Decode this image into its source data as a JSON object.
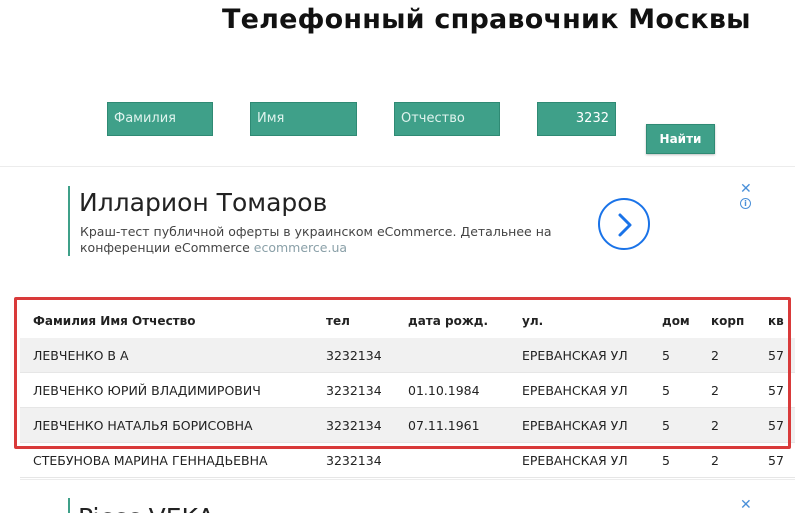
{
  "page": {
    "title": "Телефонный справочник Москвы"
  },
  "search": {
    "surname_placeholder": "Фамилия",
    "name_placeholder": "Имя",
    "patronymic_placeholder": "Отчество",
    "phone_value": "3232",
    "submit_label": "Найти"
  },
  "ad": {
    "title": "Илларион Томаров",
    "description": "Краш-тест публичной оферты в украинском eCommerce. Детальнее на конференции eCommerce",
    "domain": "ecommerce.ua",
    "close_glyph": "✕",
    "info_glyph": "i"
  },
  "ad2": {
    "title_partial": "Piccc VEKA",
    "close_glyph": "✕"
  },
  "table": {
    "headers": {
      "name": "Фамилия Имя Отчество",
      "tel": "тел",
      "dob": "дата рожд.",
      "street": "ул.",
      "house": "дом",
      "korp": "корп",
      "kv": "кв"
    },
    "rows": [
      {
        "name": "ЛЕВЧЕНКО В А",
        "tel": "3232134",
        "dob": "",
        "street": "ЕРЕВАНСКАЯ УЛ",
        "house": "5",
        "korp": "2",
        "kv": "57"
      },
      {
        "name": "ЛЕВЧЕНКО ЮРИЙ ВЛАДИМИРОВИЧ",
        "tel": "3232134",
        "dob": "01.10.1984",
        "street": "ЕРЕВАНСКАЯ УЛ",
        "house": "5",
        "korp": "2",
        "kv": "57"
      },
      {
        "name": "ЛЕВЧЕНКО НАТАЛЬЯ БОРИСОВНА",
        "tel": "3232134",
        "dob": "07.11.1961",
        "street": "ЕРЕВАНСКАЯ УЛ",
        "house": "5",
        "korp": "2",
        "kv": "57"
      },
      {
        "name": "СТЕБУНОВА МАРИНА ГЕННАДЬЕВНА",
        "tel": "3232134",
        "dob": "",
        "street": "ЕРЕВАНСКАЯ УЛ",
        "house": "5",
        "korp": "2",
        "kv": "57"
      }
    ]
  },
  "colors": {
    "accent": "#3fa089",
    "highlight": "#d93a3a",
    "ad_link": "#1a73e8"
  },
  "icons": {
    "ad_arrow": "chevron-right-icon",
    "ad_close": "close-icon",
    "ad_info": "info-icon"
  }
}
